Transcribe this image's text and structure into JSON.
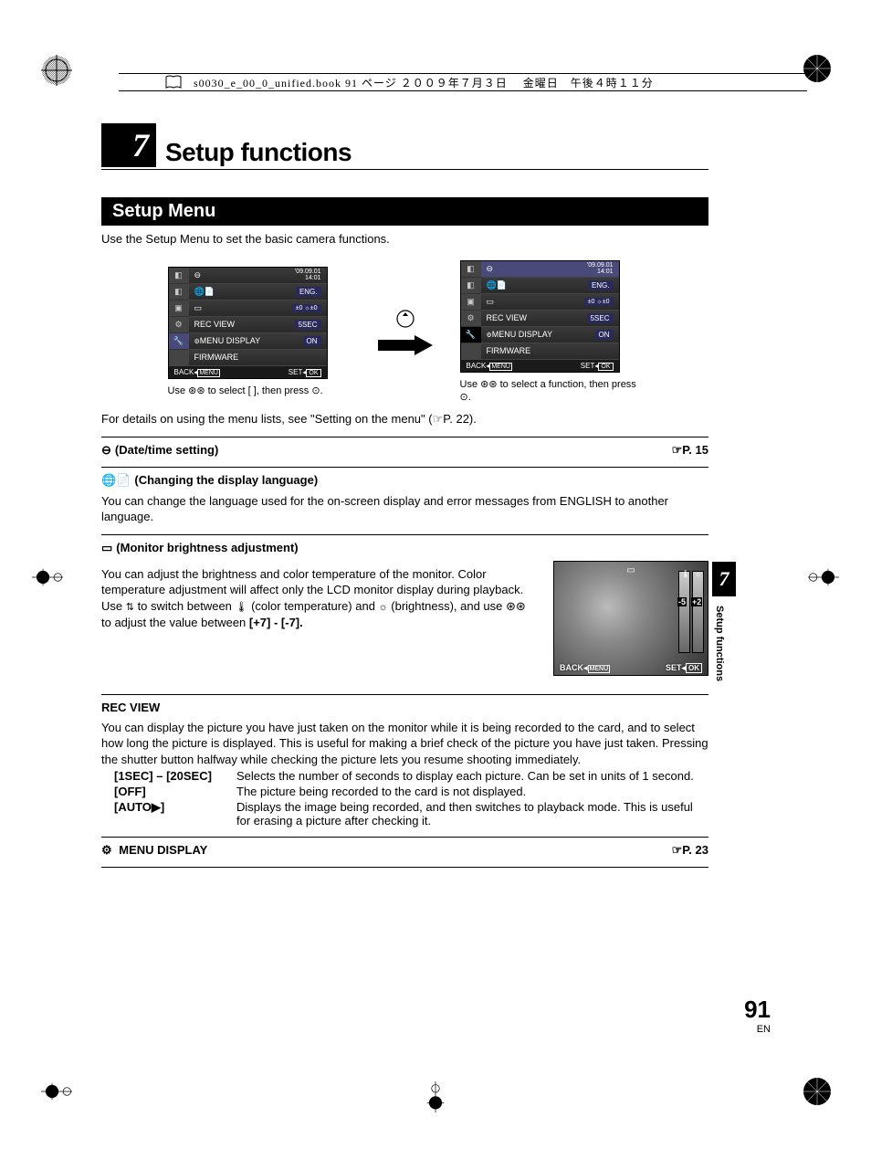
{
  "header_running": "s0030_e_00_0_unified.book  91 ページ  ２００９年７月３日 　金曜日　午後４時１１分",
  "chapter_num": "7",
  "chapter_title": "Setup functions",
  "section_title": "Setup Menu",
  "intro": "Use the Setup Menu to set the basic camera functions.",
  "menu": {
    "date": "'09.09.01",
    "time": "14:01",
    "rows": [
      {
        "label": "",
        "val": ""
      },
      {
        "label": "",
        "val": "ENG."
      },
      {
        "label": "",
        "val": "±0 ☼±0"
      },
      {
        "label": "REC VIEW",
        "val": "5SEC"
      },
      {
        "label": "MENU DISPLAY",
        "val": "ON"
      },
      {
        "label": "FIRMWARE",
        "val": ""
      }
    ],
    "back": "BACK",
    "menu": "MENU",
    "set": "SET",
    "ok": "OK"
  },
  "caption_left": "Use ⊛⊛ to select [ ], then press ⊙.",
  "caption_right": "Use ⊛⊛ to select a function, then press ⊙.",
  "details_line": "For details on using the menu lists, see \"Setting on the menu\" (☞P. 22).",
  "row_date": {
    "label": "(Date/time setting)",
    "ref": "☞P. 15"
  },
  "row_lang": {
    "label": "(Changing the display language)"
  },
  "lang_body": "You can change the language used for the on-screen display and error messages from ENGLISH to another language.",
  "row_monitor": {
    "label": "(Monitor brightness adjustment)"
  },
  "monitor_body1": "You can adjust the brightness and color temperature of the monitor. Color temperature adjustment will affect only the LCD monitor display during playback.",
  "monitor_body2a": "Use ",
  "monitor_body2b": " to switch between ",
  "monitor_body2c": " (color temperature) and ",
  "monitor_body2d": " (brightness), and use ⊛⊛ to adjust the value between ",
  "monitor_range": "[+7] - [-7].",
  "monitor_scale_a": "-5",
  "monitor_scale_b": "+2",
  "rec_view_heading": "REC VIEW",
  "rec_view_body": "You can display the picture you have just taken on the monitor while it is being recorded to the card, and to select how long the picture is displayed. This is useful for making a brief check of the picture you have just taken. Pressing the shutter button halfway while checking the picture lets you resume shooting immediately.",
  "opts": [
    {
      "k": "[1SEC] – [20SEC]",
      "v": "Selects the number of seconds to display each picture. Can be set in units of 1 second."
    },
    {
      "k": "[OFF]",
      "v": "The picture being recorded to the card is not displayed."
    },
    {
      "k": "[AUTO▶]",
      "v": "Displays the image being recorded, and then switches to playback mode. This is useful for erasing a picture after checking it."
    }
  ],
  "row_menu_display": {
    "label": "MENU DISPLAY",
    "ref": "☞P. 23"
  },
  "side_tab_num": "7",
  "side_tab_text": "Setup functions",
  "page_number": "91",
  "page_lang": "EN"
}
